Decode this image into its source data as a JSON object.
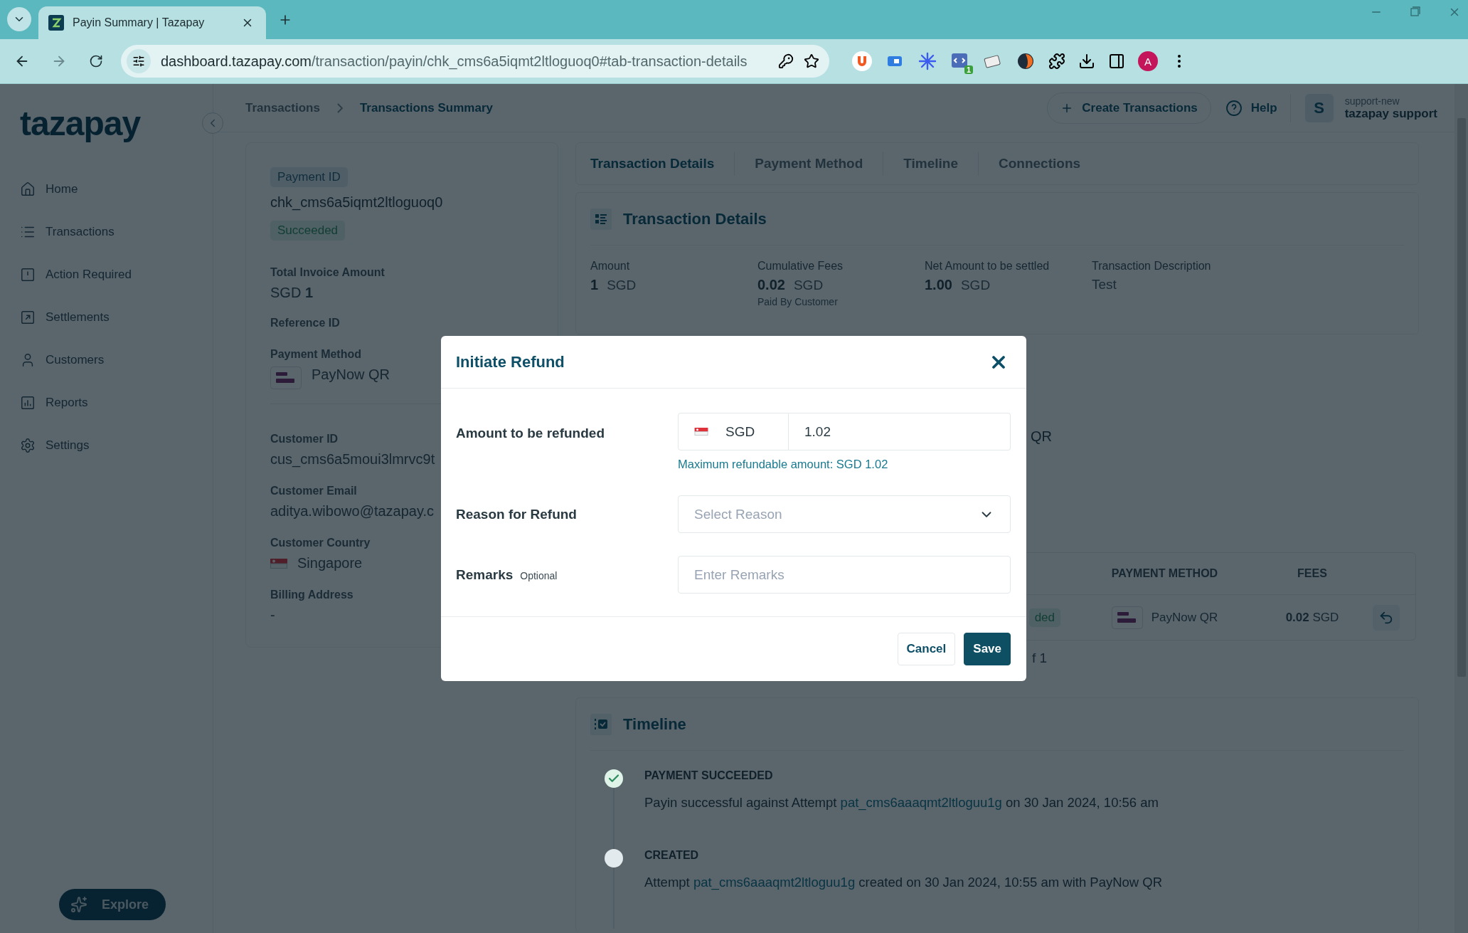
{
  "browser": {
    "tab_title": "Payin Summary | Tazapay",
    "url_host": "dashboard.tazapay.com",
    "url_path": "/transaction/payin/chk_cms6a5iqmt2ltloguoq0#tab-transaction-details",
    "extension_badge": "1",
    "profile_initial": "A"
  },
  "sidebar": {
    "logo": "tazapay",
    "items": [
      {
        "label": "Home",
        "kind": "home"
      },
      {
        "label": "Transactions",
        "kind": "list"
      },
      {
        "label": "Action Required",
        "kind": "alert"
      },
      {
        "label": "Settlements",
        "kind": "export"
      },
      {
        "label": "Customers",
        "kind": "user"
      },
      {
        "label": "Reports",
        "kind": "chart"
      },
      {
        "label": "Settings",
        "kind": "gear"
      }
    ],
    "explore": "Explore"
  },
  "header": {
    "breadcrumbs": [
      "Transactions",
      "Transactions Summary"
    ],
    "create_button": "Create Transactions",
    "help": "Help",
    "user": {
      "initial": "S",
      "org": "support-new",
      "name": "tazapay support"
    }
  },
  "summary": {
    "payment_id_label": "Payment ID",
    "payment_id": "chk_cms6a5iqmt2ltloguoq0",
    "status": "Succeeded",
    "fields": [
      {
        "label": "Total Invoice Amount",
        "value": "SGD **1**",
        "kind": "amount"
      },
      {
        "label": "Reference ID",
        "kind": "empty"
      },
      {
        "label": "Payment Method",
        "value": "PayNow QR",
        "kind": "method"
      },
      {
        "label": "Customer ID",
        "value": "cus_cms6a5moui3lmrvc9t",
        "kind": "text"
      },
      {
        "label": "Customer Email",
        "value": "aditya.wibowo@tazapay.c",
        "kind": "text"
      },
      {
        "label": "Customer Country",
        "value": "Singapore",
        "kind": "country"
      },
      {
        "label": "Billing Address",
        "value": "-",
        "kind": "text"
      }
    ]
  },
  "tabs": [
    {
      "label": "Transaction Details",
      "selected": true
    },
    {
      "label": "Payment Method",
      "selected": false
    },
    {
      "label": "Timeline",
      "selected": false
    },
    {
      "label": "Connections",
      "selected": false
    }
  ],
  "transaction_details": {
    "title": "Transaction Details",
    "fields": [
      {
        "label": "Amount",
        "value": "1",
        "unit": "SGD",
        "kind": "amount"
      },
      {
        "label": "Cumulative Fees",
        "value": "0.02",
        "unit": "SGD",
        "note": "Paid By Customer",
        "kind": "amount"
      },
      {
        "label": "Net Amount to be settled",
        "value": "1.00",
        "unit": "SGD",
        "kind": "amount"
      },
      {
        "label": "Transaction Description",
        "value": "Test",
        "kind": "text"
      }
    ]
  },
  "payment_method_section": {
    "value_fragment": "QR"
  },
  "attempts": {
    "columns": [
      "PAYMENT METHOD",
      "FEES"
    ],
    "rows": [
      {
        "status": "ded",
        "method": "PayNow QR",
        "fee_amount": "0.02",
        "fee_currency": "SGD"
      }
    ],
    "pagination": "f 1"
  },
  "timeline": {
    "title": "Timeline",
    "events": [
      {
        "title": "PAYMENT SUCCEEDED",
        "before": "Payin successful against Attempt ",
        "link": "pat_cms6aaaqmt2ltloguu1g",
        "after": " on 30 Jan 2024, 10:56 am",
        "completed": true
      },
      {
        "title": "CREATED",
        "before": "Attempt ",
        "link": "pat_cms6aaaqmt2ltloguu1g",
        "after": " created on 30 Jan 2024, 10:55 am with PayNow QR",
        "completed": false
      }
    ]
  },
  "modal": {
    "title": "Initiate Refund",
    "amount_label": "Amount to be refunded",
    "currency": "SGD",
    "amount": "1.02",
    "hint": "Maximum refundable amount: SGD 1.02",
    "reason_label": "Reason for Refund",
    "reason_placeholder": "Select Reason",
    "remarks_label": "Remarks",
    "remarks_optional": "Optional",
    "remarks_placeholder": "Enter Remarks",
    "cancel": "Cancel",
    "save": "Save"
  }
}
